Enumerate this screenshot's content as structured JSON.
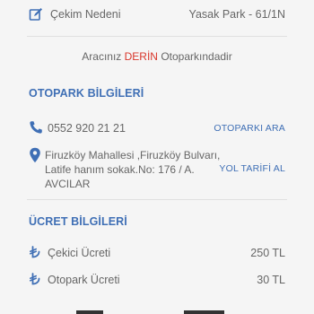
{
  "pull_reason": {
    "icon": "edit-icon",
    "label": "Çekim Nedeni",
    "value": "Yasak Park - 61/1N"
  },
  "status": {
    "prefix": "Aracınız",
    "highlight": "DERİN",
    "suffix": "Otoparkındadir",
    "highlight_color": "#d9362b"
  },
  "parking_info": {
    "title": "OTOPARK BİLGİLERİ",
    "phone": "0552 920 21 21",
    "phone_icon": "phone-icon",
    "call_action": "OTOPARKI ARA",
    "address_icon": "map-pin-icon",
    "address_line1": "Firuzköy Mahallesi ,Firuzköy Bulvarı,",
    "address_line2": "Latife hanım sokak.No: 176 / A.",
    "address_line3": "AVCILAR",
    "directions_action": "YOL TARİFİ AL"
  },
  "fee_info": {
    "title": "ÜCRET BİLGİLERİ",
    "items": [
      {
        "icon": "lira-icon",
        "label": "Çekici Ücreti",
        "value": "250 TL"
      },
      {
        "icon": "lira-icon",
        "label": "Otopark Ücreti",
        "value": "30 TL"
      }
    ]
  },
  "colors": {
    "accent": "#3f6fb5",
    "background": "#f5f5f5",
    "text": "#666666"
  }
}
